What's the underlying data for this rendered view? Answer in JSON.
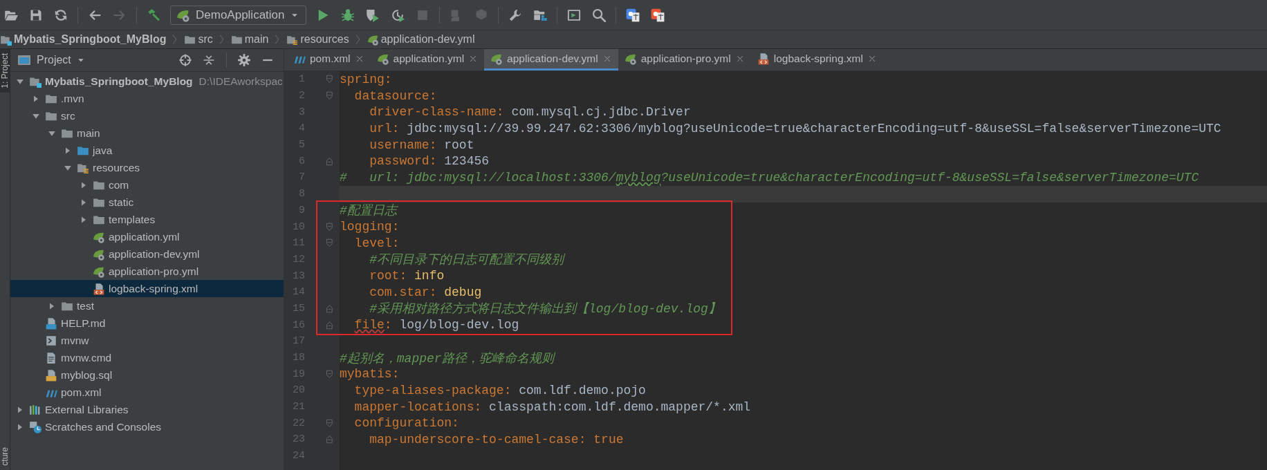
{
  "toolbar": [
    {
      "kind": "open",
      "disabled": false
    },
    {
      "kind": "save",
      "disabled": false
    },
    {
      "kind": "sync",
      "disabled": false
    },
    {
      "kind": "separator"
    },
    {
      "kind": "back",
      "disabled": false
    },
    {
      "kind": "forward",
      "disabled": true
    },
    {
      "kind": "separator"
    },
    {
      "kind": "build",
      "disabled": false
    },
    {
      "kind": "run_config",
      "label": "DemoApplication"
    },
    {
      "kind": "run",
      "disabled": false
    },
    {
      "kind": "debug",
      "disabled": false
    },
    {
      "kind": "coverage",
      "disabled": false
    },
    {
      "kind": "profile",
      "disabled": false
    },
    {
      "kind": "stop",
      "disabled": true
    },
    {
      "kind": "separator"
    },
    {
      "kind": "attach",
      "disabled": true
    },
    {
      "kind": "deploy",
      "disabled": true
    },
    {
      "kind": "separator"
    },
    {
      "kind": "settings",
      "disabled": false
    },
    {
      "kind": "structure",
      "disabled": false
    },
    {
      "kind": "separator"
    },
    {
      "kind": "terminal",
      "disabled": false
    },
    {
      "kind": "search",
      "disabled": false
    },
    {
      "kind": "separator"
    },
    {
      "kind": "translate_blue"
    },
    {
      "kind": "translate_red"
    }
  ],
  "breadcrumb": [
    {
      "label": "Mybatis_Springboot_MyBlog",
      "kind": "module"
    },
    {
      "label": "src",
      "kind": "folder"
    },
    {
      "label": "main",
      "kind": "folder"
    },
    {
      "label": "resources",
      "kind": "resources-folder"
    },
    {
      "label": "application-dev.yml",
      "kind": "spring-yml"
    }
  ],
  "side_stripe": [
    {
      "label": "1: Project",
      "selected": true
    },
    {
      "label": "cture",
      "selected": false
    }
  ],
  "project": {
    "title": "Project",
    "tree": [
      {
        "label": "Mybatis_Springboot_MyBlog",
        "path": "D:\\IDEAworkspac",
        "kind": "module",
        "expanded": true,
        "selected": false,
        "children": [
          {
            "label": ".mvn",
            "kind": "folder",
            "expanded": false,
            "selected": false
          },
          {
            "label": "src",
            "kind": "folder",
            "expanded": true,
            "selected": false,
            "children": [
              {
                "label": "main",
                "kind": "folder",
                "expanded": true,
                "selected": false,
                "children": [
                  {
                    "label": "java",
                    "kind": "source-folder",
                    "expanded": false,
                    "selected": false
                  },
                  {
                    "label": "resources",
                    "kind": "resources-folder",
                    "expanded": true,
                    "selected": false,
                    "children": [
                      {
                        "label": "com",
                        "kind": "folder",
                        "expanded": false,
                        "selected": false
                      },
                      {
                        "label": "static",
                        "kind": "folder",
                        "expanded": false,
                        "selected": false
                      },
                      {
                        "label": "templates",
                        "kind": "folder",
                        "expanded": false,
                        "selected": false
                      },
                      {
                        "label": "application.yml",
                        "kind": "spring-yml",
                        "selected": false
                      },
                      {
                        "label": "application-dev.yml",
                        "kind": "spring-yml",
                        "selected": false
                      },
                      {
                        "label": "application-pro.yml",
                        "kind": "spring-yml",
                        "selected": false
                      },
                      {
                        "label": "logback-spring.xml",
                        "kind": "xml",
                        "selected": true
                      }
                    ]
                  }
                ]
              },
              {
                "label": "test",
                "kind": "folder",
                "expanded": false,
                "selected": false
              }
            ]
          },
          {
            "label": "HELP.md",
            "kind": "md",
            "selected": false
          },
          {
            "label": "mvnw",
            "kind": "script",
            "selected": false
          },
          {
            "label": "mvnw.cmd",
            "kind": "text",
            "selected": false
          },
          {
            "label": "myblog.sql",
            "kind": "sql",
            "selected": false
          },
          {
            "label": "pom.xml",
            "kind": "maven",
            "selected": false
          }
        ]
      },
      {
        "label": "External Libraries",
        "kind": "libraries",
        "expanded": false,
        "selected": false
      },
      {
        "label": "Scratches and Consoles",
        "kind": "scratches",
        "expanded": false,
        "selected": false
      }
    ]
  },
  "tabs": [
    {
      "label": "pom.xml",
      "kind": "maven",
      "selected": false
    },
    {
      "label": "application.yml",
      "kind": "spring-yml",
      "selected": false
    },
    {
      "label": "application-dev.yml",
      "kind": "spring-yml",
      "selected": true
    },
    {
      "label": "application-pro.yml",
      "kind": "spring-yml",
      "selected": false
    },
    {
      "label": "logback-spring.xml",
      "kind": "xml",
      "selected": false
    }
  ],
  "editor": {
    "lines": [
      {
        "number": "1",
        "fold_open": true,
        "segments": [
          {
            "kind": "key",
            "text": "spring"
          },
          {
            "kind": "punct",
            "text": ":"
          }
        ]
      },
      {
        "number": "2",
        "fold_open": true,
        "segments": [
          {
            "kind": "key",
            "text": "  datasource"
          },
          {
            "kind": "punct",
            "text": ":"
          }
        ]
      },
      {
        "number": "3",
        "segments": [
          {
            "kind": "key",
            "text": "    driver-class-name"
          },
          {
            "kind": "punct",
            "text": ": "
          },
          {
            "kind": "value",
            "text": "com.mysql.cj.jdbc.Driver"
          }
        ]
      },
      {
        "number": "4",
        "segments": [
          {
            "kind": "key",
            "text": "    url"
          },
          {
            "kind": "punct",
            "text": ": "
          },
          {
            "kind": "value",
            "text": "jdbc:mysql://39.99.247.62:3306/myblog?useUnicode=true&characterEncoding=utf-8&useSSL=false&serverTimezone=UTC"
          }
        ]
      },
      {
        "number": "5",
        "segments": [
          {
            "kind": "key",
            "text": "    username"
          },
          {
            "kind": "punct",
            "text": ": "
          },
          {
            "kind": "value",
            "text": "root"
          }
        ]
      },
      {
        "number": "6",
        "fold_close": true,
        "segments": [
          {
            "kind": "key",
            "text": "    password"
          },
          {
            "kind": "punct",
            "text": ": "
          },
          {
            "kind": "value",
            "text": "123456"
          }
        ]
      },
      {
        "number": "7",
        "segments": [
          {
            "kind": "comment",
            "text": "#   url: jdbc:mysql://localhost:3306/"
          },
          {
            "kind": "comment",
            "text": "myblog",
            "misspelled": true
          },
          {
            "kind": "comment",
            "text": "?useUnicode=true&characterEncoding=utf-8&useSSL=false&serverTimezone=UTC"
          }
        ]
      },
      {
        "number": "8",
        "current": true
      },
      {
        "number": "9",
        "boxed": true,
        "segments": [
          {
            "kind": "comment",
            "text": "#配置日志"
          }
        ]
      },
      {
        "number": "10",
        "fold_open": true,
        "boxed": true,
        "segments": [
          {
            "kind": "key",
            "text": "logging"
          },
          {
            "kind": "punct",
            "text": ":"
          }
        ]
      },
      {
        "number": "11",
        "fold_open": true,
        "boxed": true,
        "segments": [
          {
            "kind": "key",
            "text": "  level"
          },
          {
            "kind": "punct",
            "text": ":"
          }
        ]
      },
      {
        "number": "12",
        "boxed": true,
        "segments": [
          {
            "kind": "comment",
            "text": "    #不同目录下的日志可配置不同级别"
          }
        ]
      },
      {
        "number": "13",
        "boxed": true,
        "segments": [
          {
            "kind": "key",
            "text": "    root"
          },
          {
            "kind": "punct",
            "text": ": "
          },
          {
            "kind": "scalar",
            "text": "info"
          }
        ]
      },
      {
        "number": "14",
        "boxed": true,
        "segments": [
          {
            "kind": "key",
            "text": "    com.star"
          },
          {
            "kind": "punct",
            "text": ": "
          },
          {
            "kind": "scalar",
            "text": "debug"
          }
        ]
      },
      {
        "number": "15",
        "fold_close": true,
        "boxed": true,
        "segments": [
          {
            "kind": "comment",
            "text": "    #采用相对路径方式将日志文件输出到【log/blog-dev.log】"
          }
        ]
      },
      {
        "number": "16",
        "fold_close": true,
        "boxed": true,
        "segments": [
          {
            "kind": "key",
            "text": "  file",
            "error": true
          },
          {
            "kind": "punct",
            "text": ": "
          },
          {
            "kind": "value",
            "text": "log/blog-dev.log"
          }
        ]
      },
      {
        "number": "17"
      },
      {
        "number": "18",
        "segments": [
          {
            "kind": "comment",
            "text": "#起别名，mapper路径，驼峰命名规则"
          }
        ]
      },
      {
        "number": "19",
        "fold_open": true,
        "segments": [
          {
            "kind": "key",
            "text": "mybatis"
          },
          {
            "kind": "punct",
            "text": ":"
          }
        ]
      },
      {
        "number": "20",
        "segments": [
          {
            "kind": "key",
            "text": "  type-aliases-package"
          },
          {
            "kind": "punct",
            "text": ": "
          },
          {
            "kind": "value",
            "text": "com.ldf.demo.pojo"
          }
        ]
      },
      {
        "number": "21",
        "segments": [
          {
            "kind": "key",
            "text": "  mapper-locations"
          },
          {
            "kind": "punct",
            "text": ": "
          },
          {
            "kind": "value",
            "text": "classpath:com.ldf.demo.mapper/*.xml"
          }
        ]
      },
      {
        "number": "22",
        "fold_open": true,
        "segments": [
          {
            "kind": "key",
            "text": "  configuration"
          },
          {
            "kind": "punct",
            "text": ":"
          }
        ]
      },
      {
        "number": "23",
        "fold_close": true,
        "segments": [
          {
            "kind": "key",
            "text": "    map-underscore-to-camel-case"
          },
          {
            "kind": "punct",
            "text": ": "
          },
          {
            "kind": "bool",
            "text": "true"
          }
        ]
      },
      {
        "number": "24"
      }
    ]
  }
}
